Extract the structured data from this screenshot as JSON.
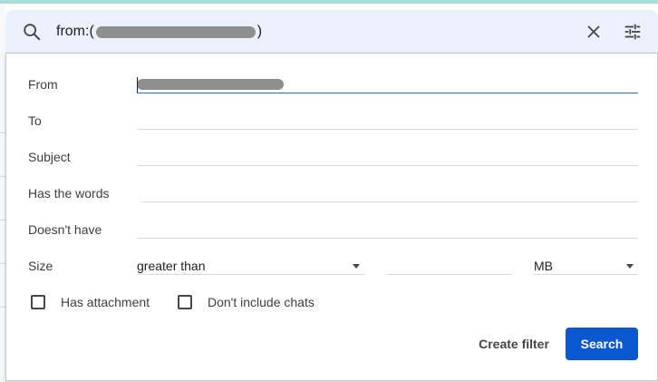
{
  "search": {
    "query_prefix": "from:(",
    "query_suffix": ")",
    "query_redacted": true
  },
  "fields": {
    "from_label": "From",
    "from_value_redacted": true,
    "to_label": "To",
    "subject_label": "Subject",
    "has_words_label": "Has the words",
    "doesnt_have_label": "Doesn't have",
    "size_label": "Size"
  },
  "size": {
    "comparison": "greater than",
    "unit": "MB"
  },
  "options": {
    "has_attachment": "Has attachment",
    "no_chats": "Don't include chats"
  },
  "actions": {
    "create_filter": "Create filter",
    "search": "Search"
  },
  "colors": {
    "primary": "#0b57d0",
    "focus_underline": "#1a73e8",
    "search_bar_bg": "#eaf1fb"
  },
  "icons": [
    "search-icon",
    "close-icon",
    "tune-icon",
    "dropdown-arrow-icon",
    "checkbox-icon"
  ]
}
